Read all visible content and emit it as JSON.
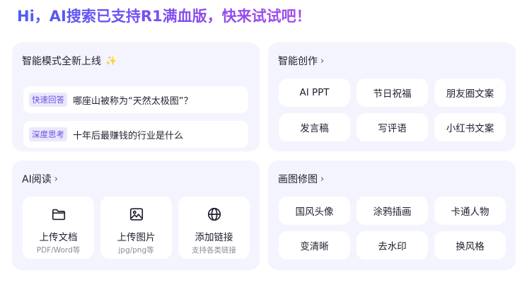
{
  "headline": "Hi，AI搜索已支持R1满血版，快来试试吧！",
  "new_mode_card": {
    "title": "智能模式全新上线",
    "icon": "sparkle-icon",
    "items": [
      {
        "tag": "快速回答",
        "text": "哪座山被称为“天然太极图”？"
      },
      {
        "tag": "深度思考",
        "text": "十年后最赚钱的行业是什么"
      }
    ]
  },
  "creation_card": {
    "title": "智能创作",
    "buttons": [
      "AI PPT",
      "节日祝福",
      "朋友圈文案",
      "发言稿",
      "写评语",
      "小红书文案"
    ]
  },
  "reading_card": {
    "title": "AI阅读",
    "tiles": [
      {
        "label": "上传文档",
        "sub": "PDF/Word等",
        "icon": "folder-icon"
      },
      {
        "label": "上传图片",
        "sub": "jpg/png等",
        "icon": "image-icon"
      },
      {
        "label": "添加链接",
        "sub": "支持各类链接",
        "icon": "globe-icon"
      }
    ]
  },
  "image_card": {
    "title": "画图修图",
    "buttons": [
      "国风头像",
      "涂鸦插画",
      "卡通人物",
      "变清晰",
      "去水印",
      "换风格"
    ]
  }
}
